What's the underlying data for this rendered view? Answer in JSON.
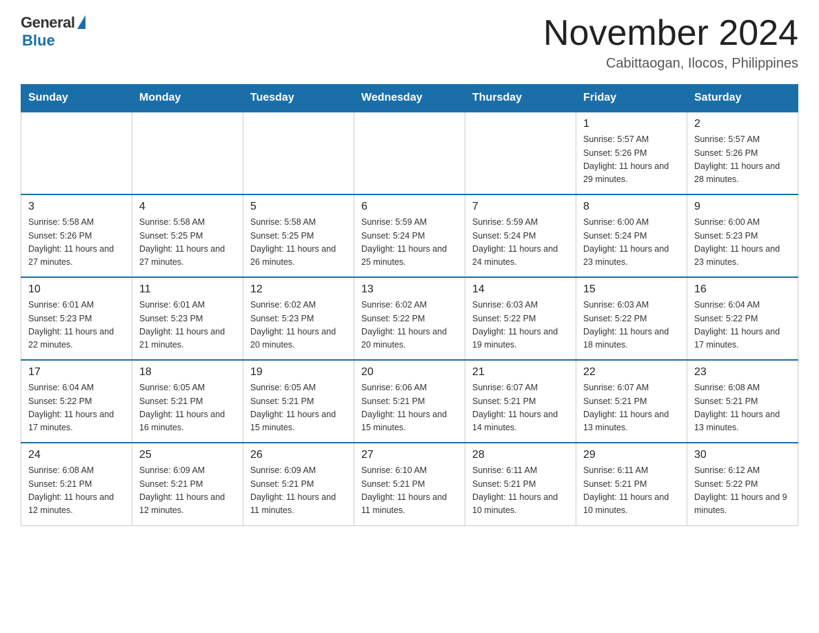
{
  "header": {
    "logo_general": "General",
    "logo_blue": "Blue",
    "main_title": "November 2024",
    "subtitle": "Cabittaogan, Ilocos, Philippines"
  },
  "weekdays": [
    "Sunday",
    "Monday",
    "Tuesday",
    "Wednesday",
    "Thursday",
    "Friday",
    "Saturday"
  ],
  "weeks": [
    [
      {
        "day": "",
        "info": ""
      },
      {
        "day": "",
        "info": ""
      },
      {
        "day": "",
        "info": ""
      },
      {
        "day": "",
        "info": ""
      },
      {
        "day": "",
        "info": ""
      },
      {
        "day": "1",
        "info": "Sunrise: 5:57 AM\nSunset: 5:26 PM\nDaylight: 11 hours and 29 minutes."
      },
      {
        "day": "2",
        "info": "Sunrise: 5:57 AM\nSunset: 5:26 PM\nDaylight: 11 hours and 28 minutes."
      }
    ],
    [
      {
        "day": "3",
        "info": "Sunrise: 5:58 AM\nSunset: 5:26 PM\nDaylight: 11 hours and 27 minutes."
      },
      {
        "day": "4",
        "info": "Sunrise: 5:58 AM\nSunset: 5:25 PM\nDaylight: 11 hours and 27 minutes."
      },
      {
        "day": "5",
        "info": "Sunrise: 5:58 AM\nSunset: 5:25 PM\nDaylight: 11 hours and 26 minutes."
      },
      {
        "day": "6",
        "info": "Sunrise: 5:59 AM\nSunset: 5:24 PM\nDaylight: 11 hours and 25 minutes."
      },
      {
        "day": "7",
        "info": "Sunrise: 5:59 AM\nSunset: 5:24 PM\nDaylight: 11 hours and 24 minutes."
      },
      {
        "day": "8",
        "info": "Sunrise: 6:00 AM\nSunset: 5:24 PM\nDaylight: 11 hours and 23 minutes."
      },
      {
        "day": "9",
        "info": "Sunrise: 6:00 AM\nSunset: 5:23 PM\nDaylight: 11 hours and 23 minutes."
      }
    ],
    [
      {
        "day": "10",
        "info": "Sunrise: 6:01 AM\nSunset: 5:23 PM\nDaylight: 11 hours and 22 minutes."
      },
      {
        "day": "11",
        "info": "Sunrise: 6:01 AM\nSunset: 5:23 PM\nDaylight: 11 hours and 21 minutes."
      },
      {
        "day": "12",
        "info": "Sunrise: 6:02 AM\nSunset: 5:23 PM\nDaylight: 11 hours and 20 minutes."
      },
      {
        "day": "13",
        "info": "Sunrise: 6:02 AM\nSunset: 5:22 PM\nDaylight: 11 hours and 20 minutes."
      },
      {
        "day": "14",
        "info": "Sunrise: 6:03 AM\nSunset: 5:22 PM\nDaylight: 11 hours and 19 minutes."
      },
      {
        "day": "15",
        "info": "Sunrise: 6:03 AM\nSunset: 5:22 PM\nDaylight: 11 hours and 18 minutes."
      },
      {
        "day": "16",
        "info": "Sunrise: 6:04 AM\nSunset: 5:22 PM\nDaylight: 11 hours and 17 minutes."
      }
    ],
    [
      {
        "day": "17",
        "info": "Sunrise: 6:04 AM\nSunset: 5:22 PM\nDaylight: 11 hours and 17 minutes."
      },
      {
        "day": "18",
        "info": "Sunrise: 6:05 AM\nSunset: 5:21 PM\nDaylight: 11 hours and 16 minutes."
      },
      {
        "day": "19",
        "info": "Sunrise: 6:05 AM\nSunset: 5:21 PM\nDaylight: 11 hours and 15 minutes."
      },
      {
        "day": "20",
        "info": "Sunrise: 6:06 AM\nSunset: 5:21 PM\nDaylight: 11 hours and 15 minutes."
      },
      {
        "day": "21",
        "info": "Sunrise: 6:07 AM\nSunset: 5:21 PM\nDaylight: 11 hours and 14 minutes."
      },
      {
        "day": "22",
        "info": "Sunrise: 6:07 AM\nSunset: 5:21 PM\nDaylight: 11 hours and 13 minutes."
      },
      {
        "day": "23",
        "info": "Sunrise: 6:08 AM\nSunset: 5:21 PM\nDaylight: 11 hours and 13 minutes."
      }
    ],
    [
      {
        "day": "24",
        "info": "Sunrise: 6:08 AM\nSunset: 5:21 PM\nDaylight: 11 hours and 12 minutes."
      },
      {
        "day": "25",
        "info": "Sunrise: 6:09 AM\nSunset: 5:21 PM\nDaylight: 11 hours and 12 minutes."
      },
      {
        "day": "26",
        "info": "Sunrise: 6:09 AM\nSunset: 5:21 PM\nDaylight: 11 hours and 11 minutes."
      },
      {
        "day": "27",
        "info": "Sunrise: 6:10 AM\nSunset: 5:21 PM\nDaylight: 11 hours and 11 minutes."
      },
      {
        "day": "28",
        "info": "Sunrise: 6:11 AM\nSunset: 5:21 PM\nDaylight: 11 hours and 10 minutes."
      },
      {
        "day": "29",
        "info": "Sunrise: 6:11 AM\nSunset: 5:21 PM\nDaylight: 11 hours and 10 minutes."
      },
      {
        "day": "30",
        "info": "Sunrise: 6:12 AM\nSunset: 5:22 PM\nDaylight: 11 hours and 9 minutes."
      }
    ]
  ]
}
